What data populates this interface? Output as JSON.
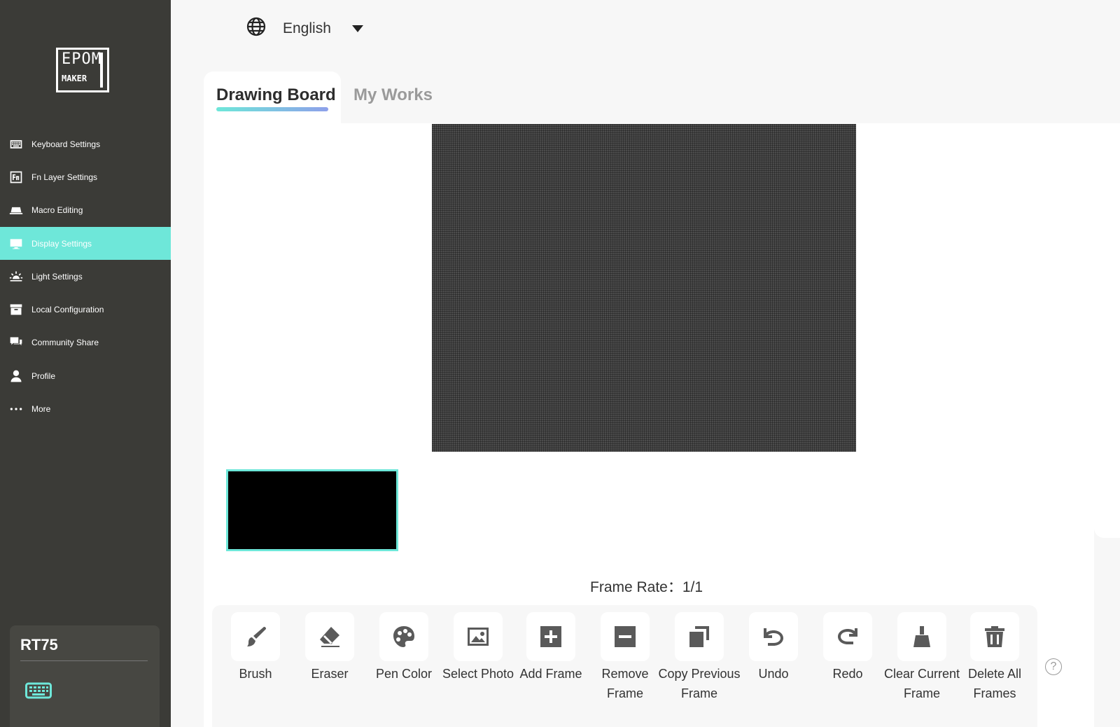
{
  "sidebar": {
    "logo": {
      "line1": "EPOM",
      "line2": "MAKER"
    },
    "items": [
      {
        "label": "Keyboard Settings",
        "icon": "keyboard-icon",
        "active": false
      },
      {
        "label": "Fn Layer Settings",
        "icon": "fn-icon",
        "active": false
      },
      {
        "label": "Macro Editing",
        "icon": "macro-icon",
        "active": false
      },
      {
        "label": "Display Settings",
        "icon": "monitor-icon",
        "active": true
      },
      {
        "label": "Light Settings",
        "icon": "light-icon",
        "active": false
      },
      {
        "label": "Local Configuration",
        "icon": "archive-icon",
        "active": false
      },
      {
        "label": "Community Share",
        "icon": "chat-icon",
        "active": false
      },
      {
        "label": "Profile",
        "icon": "person-icon",
        "active": false
      },
      {
        "label": "More",
        "icon": "more-icon",
        "active": false
      }
    ],
    "device": {
      "name": "RT75",
      "icon": "keyboard-icon"
    }
  },
  "header": {
    "language": {
      "value": "English",
      "icon": "globe-icon"
    }
  },
  "tabs": [
    {
      "label": "Drawing Board",
      "active": true
    },
    {
      "label": "My Works",
      "active": false
    }
  ],
  "frame_rate": {
    "label": "Frame Rate：",
    "value": "1/1"
  },
  "toolbar": {
    "tools": [
      {
        "label": "Brush",
        "icon": "brush-icon"
      },
      {
        "label": "Eraser",
        "icon": "eraser-icon"
      },
      {
        "label": "Pen Color",
        "icon": "palette-icon"
      },
      {
        "label": "Select Photo",
        "icon": "image-icon"
      },
      {
        "label": "Add Frame",
        "icon": "plus-square-icon"
      },
      {
        "label": "Remove Frame",
        "icon": "minus-square-icon"
      },
      {
        "label": "Copy Previous Frame",
        "icon": "copy-icon"
      },
      {
        "label": "Undo",
        "icon": "undo-icon"
      },
      {
        "label": "Redo",
        "icon": "redo-icon"
      },
      {
        "label": "Clear Current Frame",
        "icon": "broom-icon"
      },
      {
        "label": "Delete All Frames",
        "icon": "trash-icon"
      }
    ],
    "help": "?"
  },
  "colors": {
    "sidebar_bg": "#3b3b37",
    "accent": "#6ee7d9",
    "canvas": "#4c4c4c"
  }
}
